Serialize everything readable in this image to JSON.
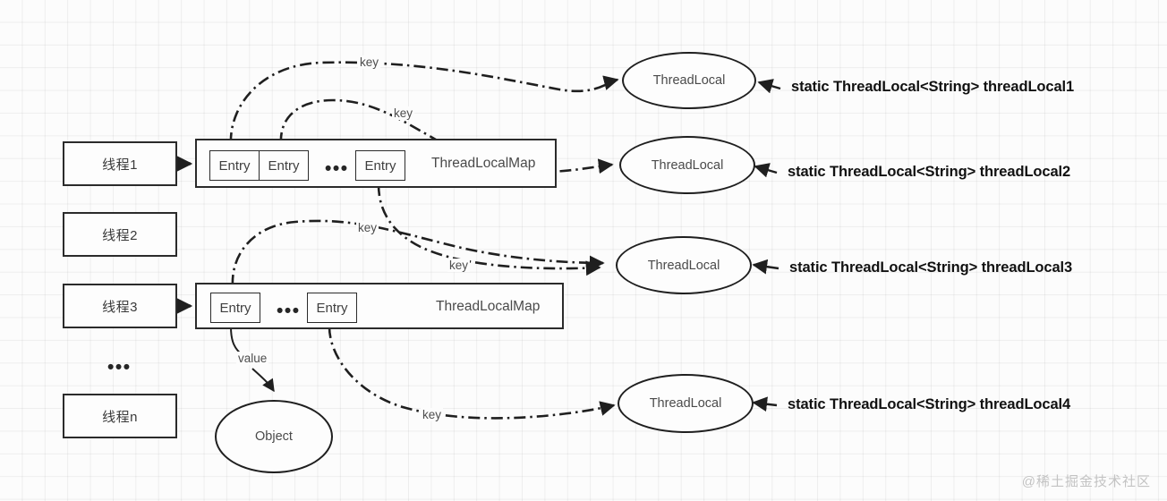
{
  "diagram": {
    "title": "ThreadLocal / ThreadLocalMap reference structure",
    "watermark": "@稀土掘金技术社区",
    "colors": {
      "stroke": "#1f1f1f",
      "text": "#3a3a3a",
      "bold_text": "#111111",
      "grid": "#f0f0f0",
      "background": "#fcfcfc",
      "watermark": "#c3c3c3"
    },
    "threads": [
      {
        "label": "线程1"
      },
      {
        "label": "线程2"
      },
      {
        "label": "线程3"
      },
      {
        "label": "线程n"
      }
    ],
    "thread_ellipsis": "•••",
    "maps": [
      {
        "label": "ThreadLocalMap",
        "entries": [
          "Entry",
          "Entry",
          "Entry"
        ],
        "ellipsis": "•••"
      },
      {
        "label": "ThreadLocalMap",
        "entries": [
          "Entry",
          "Entry"
        ],
        "ellipsis": "•••"
      }
    ],
    "threadlocals": [
      {
        "label": "ThreadLocal",
        "declaration": "static ThreadLocal<String> threadLocal1"
      },
      {
        "label": "ThreadLocal",
        "declaration": "static ThreadLocal<String> threadLocal2"
      },
      {
        "label": "ThreadLocal",
        "declaration": "static ThreadLocal<String> threadLocal3"
      },
      {
        "label": "ThreadLocal",
        "declaration": "static ThreadLocal<String> threadLocal4"
      }
    ],
    "object_node": {
      "label": "Object"
    },
    "edge_labels": {
      "key1": "key",
      "key2": "key",
      "key3": "key",
      "key4": "key",
      "key5": "key",
      "value": "value"
    }
  }
}
